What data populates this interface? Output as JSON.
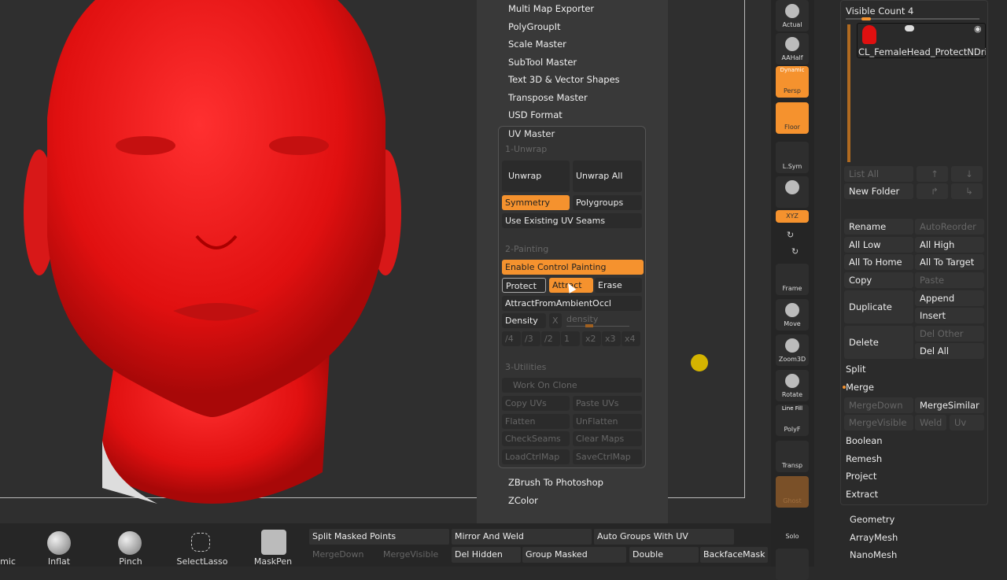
{
  "colors": {
    "accent": "#f5922e",
    "model": "#ee1c1c",
    "background": "#2a2a2a"
  },
  "menu": {
    "items_top": [
      "Multi Map Exporter",
      "PolyGroupIt",
      "Scale Master",
      "SubTool Master",
      "Text 3D & Vector Shapes",
      "Transpose Master",
      "USD Format"
    ],
    "items_bottom": [
      "ZBrush To Photoshop",
      "ZColor"
    ]
  },
  "uv_master": {
    "title": "UV Master",
    "sec1": "1-Unwrap",
    "unwrap": "Unwrap",
    "unwrap_all": "Unwrap All",
    "symmetry": "Symmetry",
    "polygroups": "Polygroups",
    "use_seams": "Use Existing UV Seams",
    "sec2": "2-Painting",
    "enable_cp": "Enable Control Painting",
    "protect": "Protect",
    "attract": "Attract",
    "erase": "Erase",
    "attract_ao": "AttractFromAmbientOccl",
    "density": "Density",
    "density_x": "X",
    "density_slider": "density",
    "density_mults": [
      "/4",
      "/3",
      "/2",
      "1",
      "x2",
      "x3",
      "x4"
    ],
    "sec3": "3-Utilities",
    "work_on_clone": "Work On Clone",
    "copy_uvs": "Copy UVs",
    "paste_uvs": "Paste UVs",
    "flatten": "Flatten",
    "unflatten": "UnFlatten",
    "check_seams": "CheckSeams",
    "clear_maps": "Clear Maps",
    "load_ctrl": "LoadCtrlMap",
    "save_ctrl": "SaveCtrlMap"
  },
  "shelf": [
    "Actual",
    "AAHalf",
    "Persp",
    "Floor",
    "L.Sym",
    "",
    "XYZ",
    "",
    "",
    "Frame",
    "Move",
    "Zoom3D",
    "Rotate",
    "PolyF",
    "Transp",
    "Ghost",
    "Solo"
  ],
  "shelf_extra": {
    "dynamic": "Dynamic",
    "line_fill": "Line Fill"
  },
  "subtool": {
    "visible_count": "Visible Count 4",
    "subtool_name": "CL_FemaleHead_ProtectNDrive",
    "list_all": "List All",
    "new_folder": "New Folder",
    "rename": "Rename",
    "auto_reorder": "AutoReorder",
    "all_low": "All Low",
    "all_high": "All High",
    "all_to_home": "All To Home",
    "all_to_target": "All To Target",
    "copy": "Copy",
    "paste": "Paste",
    "duplicate": "Duplicate",
    "append": "Append",
    "insert": "Insert",
    "delete": "Delete",
    "del_other": "Del Other",
    "del_all": "Del All",
    "split": "Split",
    "merge": "Merge",
    "merge_down": "MergeDown",
    "merge_similar": "MergeSimilar",
    "merge_visible": "MergeVisible",
    "weld": "Weld",
    "uv": "Uv",
    "boolean": "Boolean",
    "remesh": "Remesh",
    "project": "Project",
    "extract": "Extract",
    "geometry": "Geometry",
    "arraymesh": "ArrayMesh",
    "nanomesh": "NanoMesh"
  },
  "bottom": {
    "tools": [
      "mic",
      "Inflat",
      "Pinch",
      "SelectLasso",
      "MaskPen"
    ],
    "row1": [
      "Split Masked Points",
      "Mirror And Weld",
      "Auto Groups With UV"
    ],
    "row2": [
      "MergeDown",
      "MergeVisible",
      "Del Hidden",
      "Group Masked",
      "Double",
      "BackfaceMask"
    ]
  }
}
